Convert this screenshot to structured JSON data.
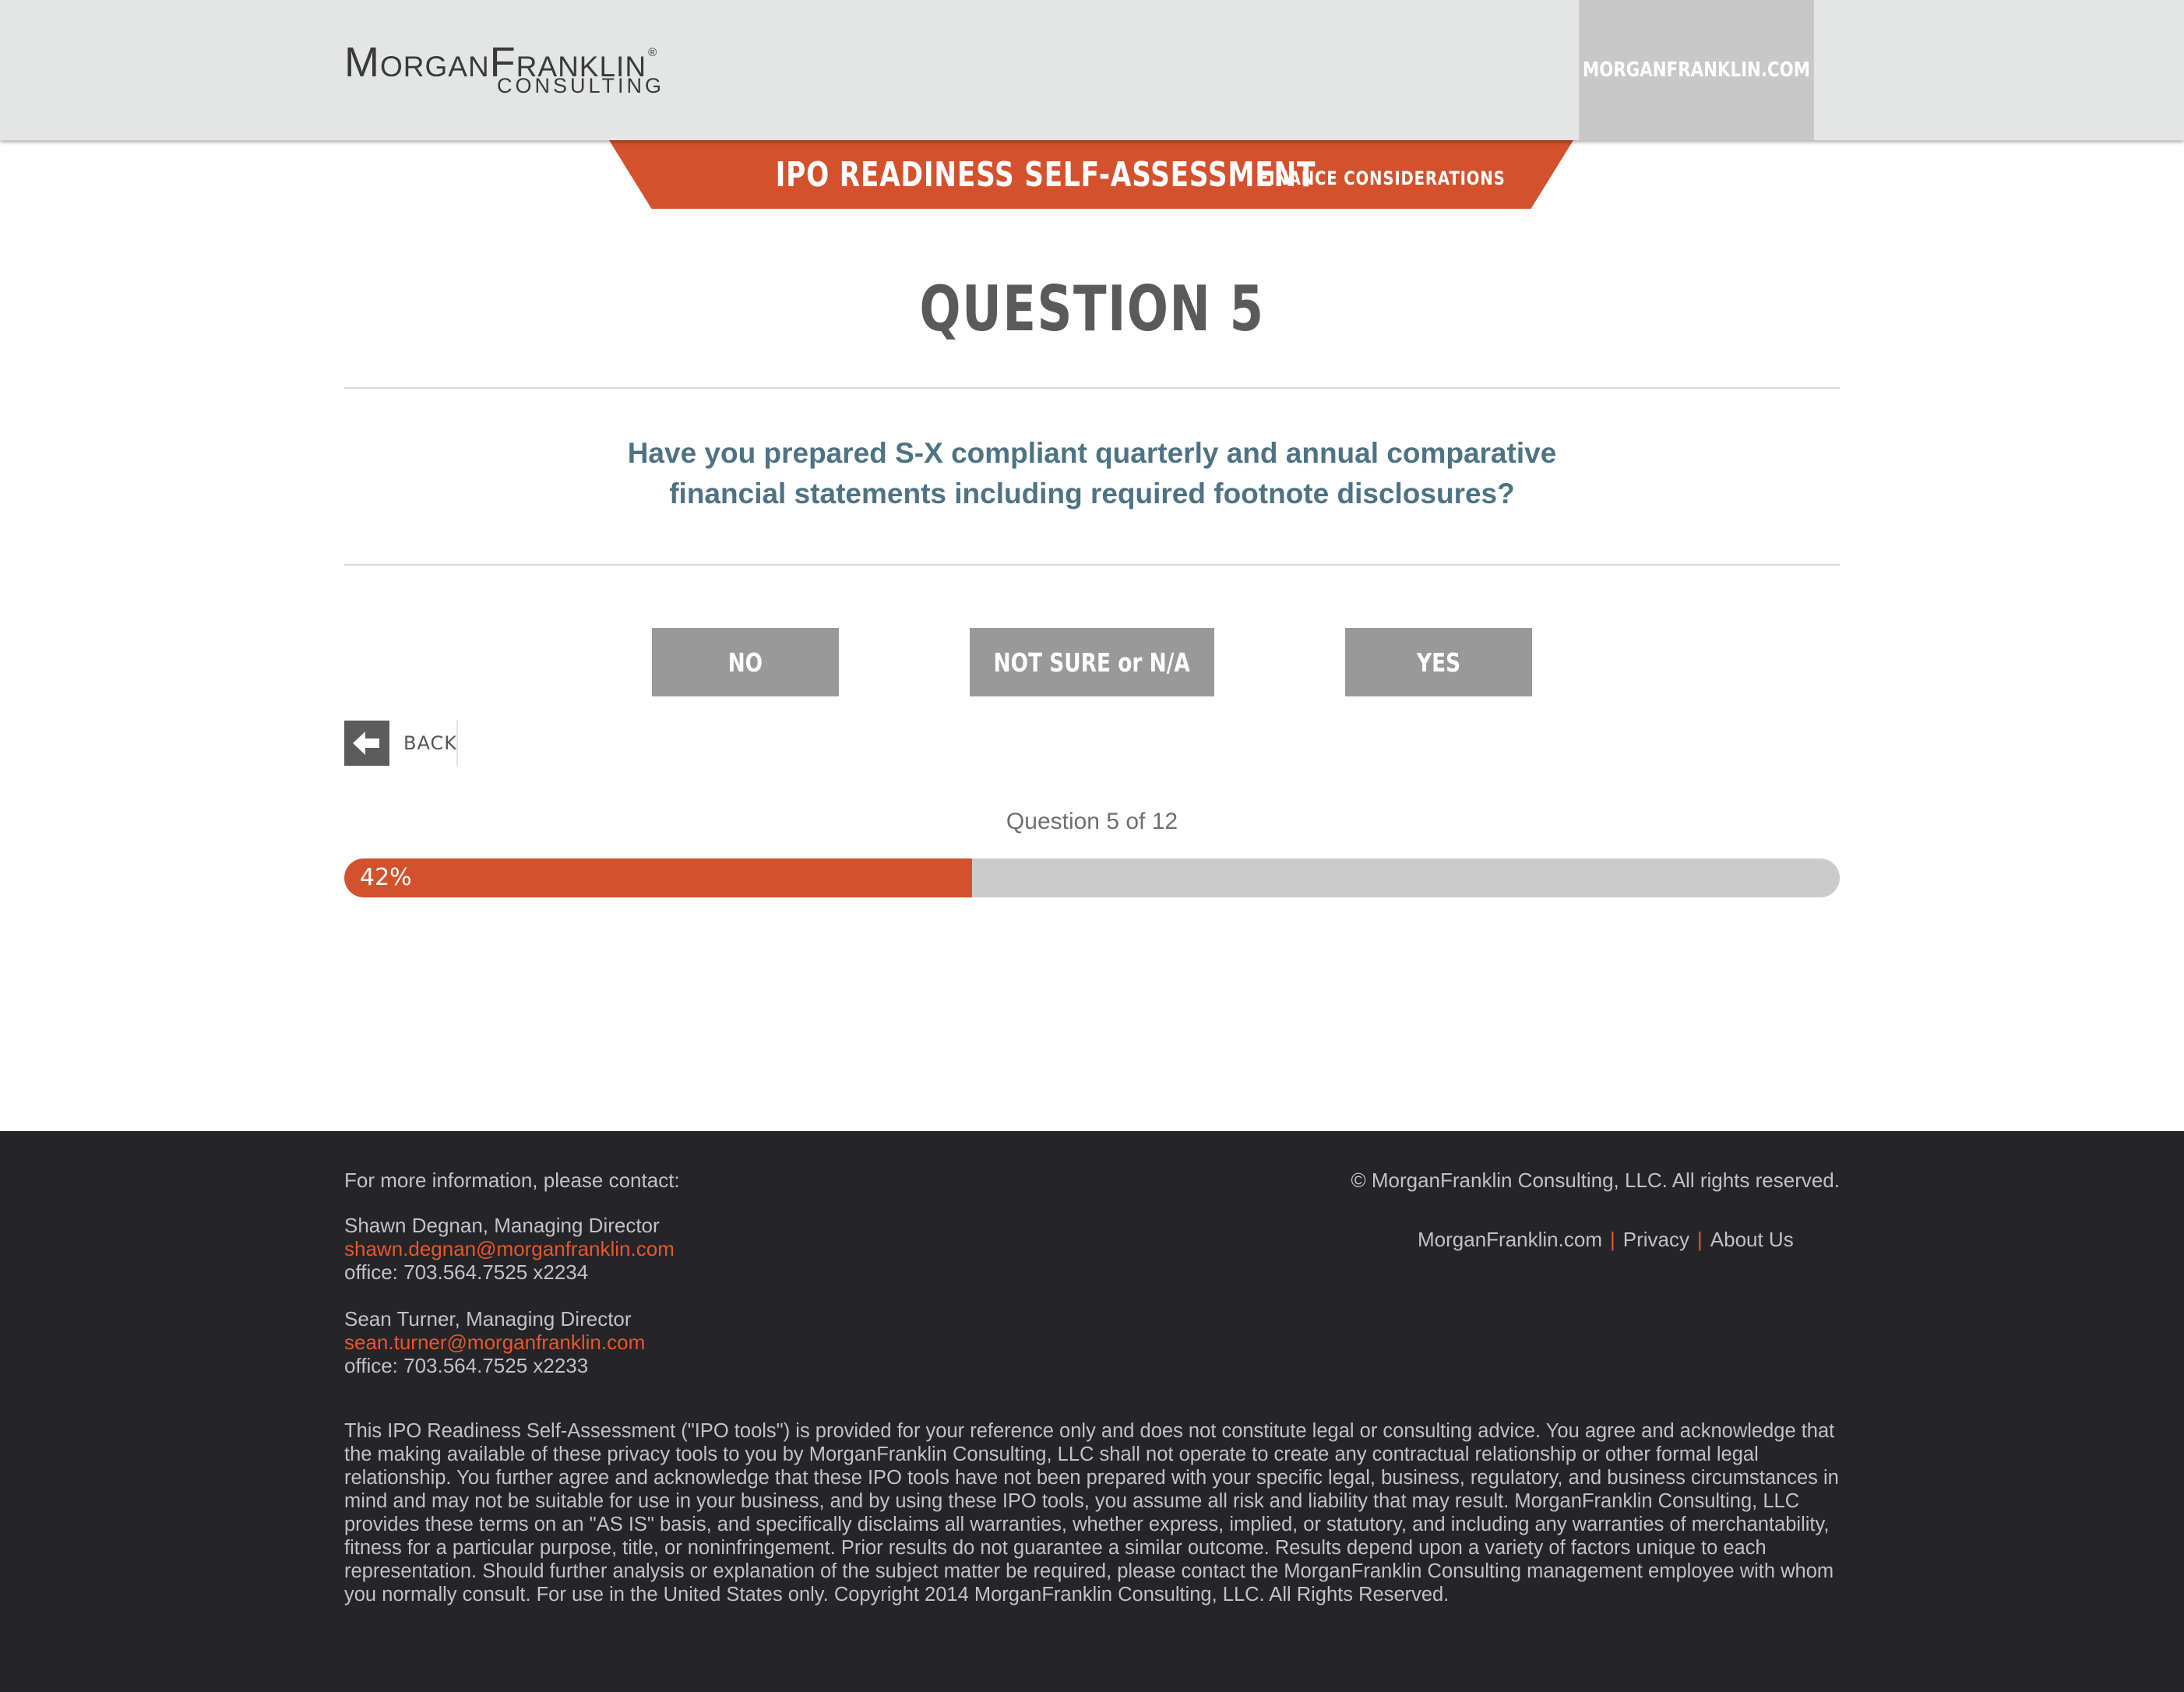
{
  "header": {
    "logo_main": "MorganFranklin",
    "logo_sub": "CONSULTING",
    "site_link": "MORGANFRANKLIN.COM"
  },
  "banner": {
    "title": "IPO READINESS SELF-ASSESSMENT",
    "subtitle": "FINANCE CONSIDERATIONS"
  },
  "question": {
    "heading": "QUESTION 5",
    "text": "Have you prepared S-X compliant quarterly and annual comparative financial statements including required footnote disclosures?"
  },
  "answers": {
    "no": "NO",
    "not_sure": "NOT SURE or N/A",
    "yes": "YES"
  },
  "back": {
    "label": "BACK",
    "icon": "arrow-left-icon"
  },
  "progress": {
    "label": "Question 5 of 12",
    "percent_label": "42%",
    "fraction": 0.42
  },
  "footer": {
    "intro": "For more information, please contact:",
    "contacts": [
      {
        "name": "Shawn Degnan, Managing Director",
        "email": "shawn.degnan@morganfranklin.com",
        "phone": "office: 703.564.7525 x2234"
      },
      {
        "name": "Sean Turner, Managing Director",
        "email": "sean.turner@morganfranklin.com",
        "phone": "office: 703.564.7525 x2233"
      }
    ],
    "copyright": "© MorganFranklin Consulting, LLC. All rights reserved.",
    "links": {
      "site": "MorganFranklin.com",
      "privacy": "Privacy",
      "about": "About Us",
      "separator": "|"
    },
    "disclaimer": "This IPO Readiness Self-Assessment (\"IPO tools\") is provided for your reference only and does not constitute legal or consulting advice. You agree and acknowledge that the making available of these privacy tools to you by MorganFranklin Consulting, LLC shall not operate to create any contractual relationship or other formal legal relationship. You further agree and acknowledge that these IPO tools have not been prepared with your specific legal, business, regulatory, and business circumstances in mind and may not be suitable for use in your business, and by using these IPO tools, you assume all risk and liability that may result. MorganFranklin Consulting, LLC provides these terms on an \"AS IS\" basis, and specifically disclaims all warranties, whether express, implied, or statutory, and including any warranties of merchantability, fitness for a particular purpose, title, or noninfringement. Prior results do not guarantee a similar outcome. Results depend upon a variety of factors unique to each representation. Should further analysis or explanation of the subject matter be required, please contact the MorganFranklin Consulting management employee with whom you normally consult. For use in the United States only. Copyright 2014 MorganFranklin Consulting, LLC. All Rights Reserved."
  },
  "colors": {
    "accent": "#d3522d",
    "header_bg": "#e4e6e6",
    "button_bg": "#999999",
    "question_text": "#4e7384",
    "footer_bg": "#242429",
    "link": "#e8572b"
  }
}
